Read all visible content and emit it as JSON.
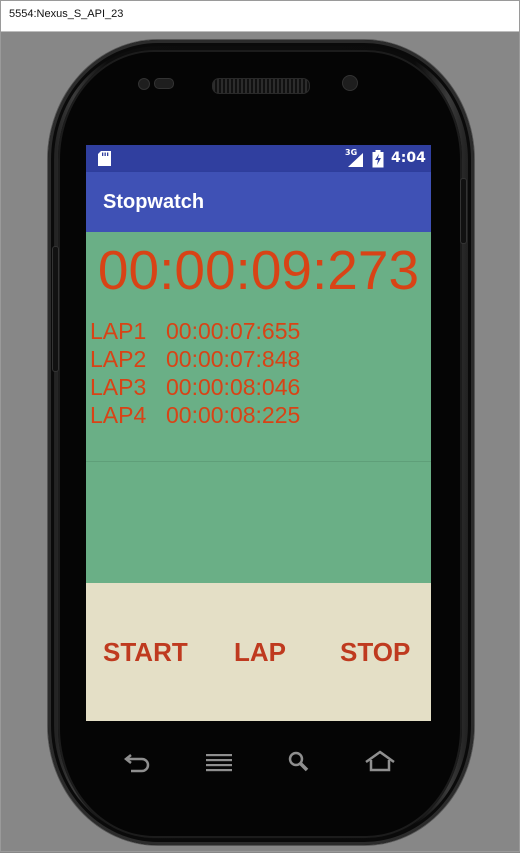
{
  "window": {
    "title": "5554:Nexus_S_API_23"
  },
  "status_bar": {
    "network": "3G",
    "time": "4:04",
    "icons": [
      "sd-card-icon",
      "signal-icon",
      "battery-icon"
    ]
  },
  "app_bar": {
    "title": "Stopwatch"
  },
  "timer": {
    "display": "00:00:09:273"
  },
  "laps": [
    {
      "label": "LAP1",
      "time": "00:00:07:655"
    },
    {
      "label": "LAP2",
      "time": "00:00:07:848"
    },
    {
      "label": "LAP3",
      "time": "00:00:08:046"
    },
    {
      "label": "LAP4",
      "time": "00:00:08:225"
    }
  ],
  "controls": {
    "start": "START",
    "lap": "LAP",
    "stop": "STOP"
  },
  "nav_buttons": [
    "back-icon",
    "menu-icon",
    "search-icon",
    "home-icon"
  ],
  "colors": {
    "status_bar": "#303f9f",
    "app_bar": "#3f51b5",
    "content_bg": "#6aaf86",
    "controls_bg": "#e4dfc6",
    "timer_text": "#d84316",
    "button_text": "#bf3a1f"
  }
}
